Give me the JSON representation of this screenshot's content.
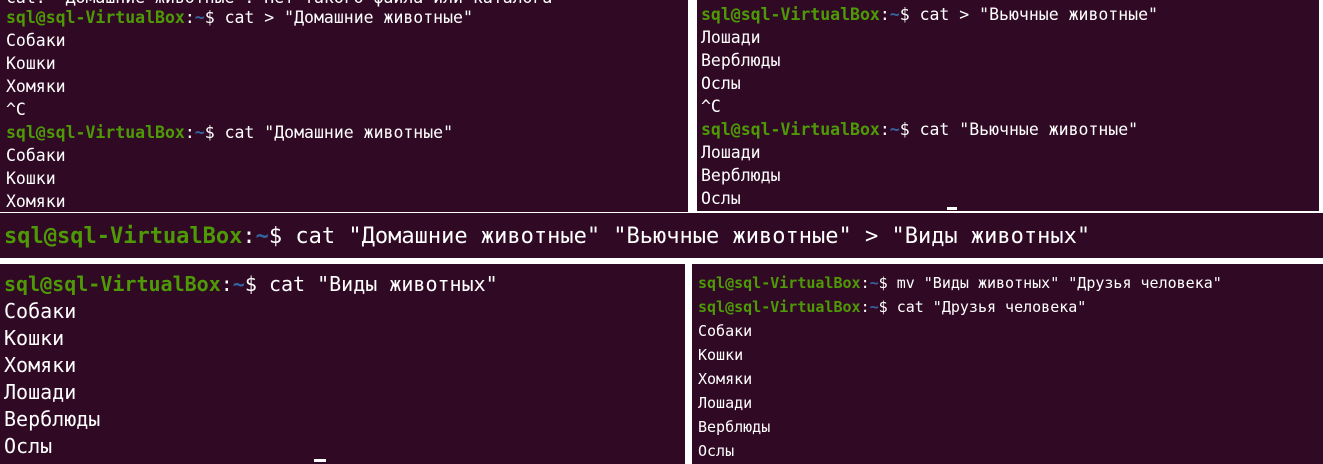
{
  "prompt": {
    "user": "sql@sql-VirtualBox",
    "colon": ":",
    "path": "~",
    "dollar": "$ "
  },
  "panel1": {
    "cut_top": "cat: \"Домашние животные\": Нет такого файла или каталога",
    "cmd1": "cat > \"Домашние животные\"",
    "input": [
      "Собаки",
      "Кошки",
      "Хомяки",
      "^C"
    ],
    "cmd2": "cat \"Домашние животные\"",
    "output": [
      "Собаки",
      "Кошки",
      "Хомяки"
    ]
  },
  "panel2": {
    "cmd1": "cat > \"Вьючные животные\"",
    "input": [
      "Лошади",
      "Верблюды",
      "Ослы",
      "^C"
    ],
    "cmd2": "cat \"Вьючные животные\"",
    "output": [
      "Лошади",
      "Верблюды",
      "Ослы"
    ]
  },
  "panel3": {
    "cmd": "cat \"Домашние животные\" \"Вьючные животные\" > \"Виды животных\""
  },
  "panel4": {
    "cmd": "cat \"Виды животных\"",
    "output": [
      "Собаки",
      "Кошки",
      "Хомяки",
      "Лошади",
      "Верблюды",
      "Ослы"
    ]
  },
  "panel5": {
    "cmd1": "mv \"Виды животных\" \"Друзья человека\"",
    "cmd2": "cat \"Друзья человека\"",
    "output": [
      "Собаки",
      "Кошки",
      "Хомяки",
      "Лошади",
      "Верблюды",
      "Ослы"
    ]
  },
  "colors": {
    "terminal_bg": "#300a24",
    "user_host": "#4e9a06",
    "path": "#3465a4",
    "text": "#ffffff"
  }
}
